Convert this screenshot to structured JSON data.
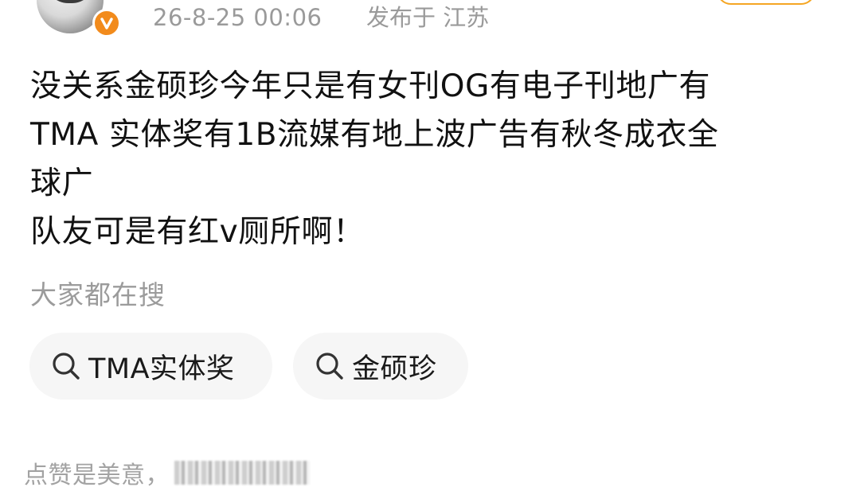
{
  "header": {
    "timestamp": "26-8-25 00:06",
    "location": "发布于 江苏"
  },
  "post": {
    "lines": [
      "没关系金硕珍今年只是有女刊OG有电子刊地广有",
      "TMA 实体奖有1B流媒有地上波广告有秋冬成衣全",
      "球广",
      "队友可是有红v厕所啊！"
    ]
  },
  "search": {
    "heading": "大家都在搜",
    "chips": [
      {
        "label": "TMA实体奖",
        "icon": "search-icon"
      },
      {
        "label": "金硕珍",
        "icon": "search-icon"
      }
    ]
  },
  "footer": {
    "text": "点赞是美意，"
  },
  "colors": {
    "badge": "#f28b1c",
    "meta_text": "#9a9a9a",
    "chip_bg": "#f6f6f6",
    "follow_border": "#f5a623"
  }
}
